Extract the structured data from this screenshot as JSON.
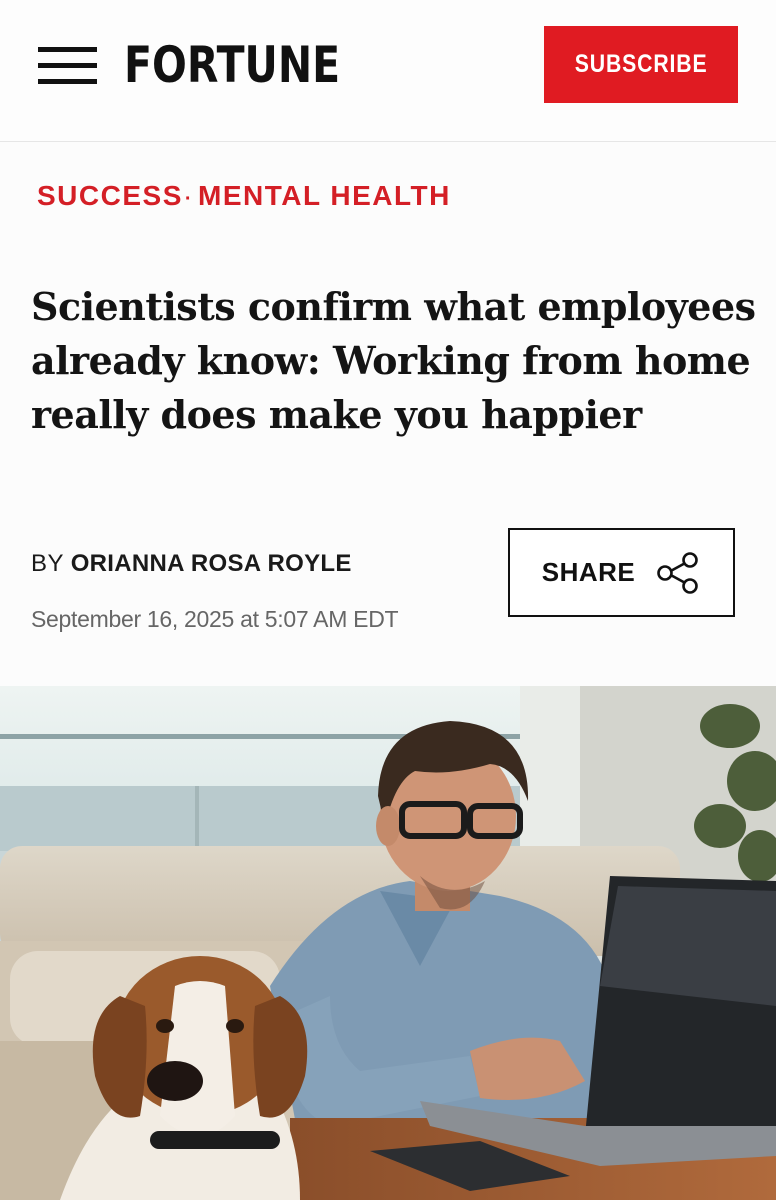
{
  "header": {
    "logo": "FORTUNE",
    "subscribe_label": "SUBSCRIBE",
    "menu_icon": "hamburger-menu-icon"
  },
  "article": {
    "categories": [
      "SUCCESS",
      "MENTAL HEALTH"
    ],
    "category_separator": "·",
    "headline": "Scientists confirm what employees already know: Working from home really does make you happier",
    "byline_prefix": "BY",
    "author": "ORIANNA ROSA ROYLE",
    "date": "September 16, 2025 at 5:07 AM EDT",
    "share_label": "SHARE",
    "share_icon": "share-icon"
  },
  "hero_image": {
    "subject": "man-with-glasses-working-on-laptop-with-beagle",
    "icon": "hero-photo"
  },
  "colors": {
    "brand_red": "#e01b22",
    "category_red": "#d41f26",
    "text_dark": "#141414",
    "date_gray": "#666666"
  }
}
